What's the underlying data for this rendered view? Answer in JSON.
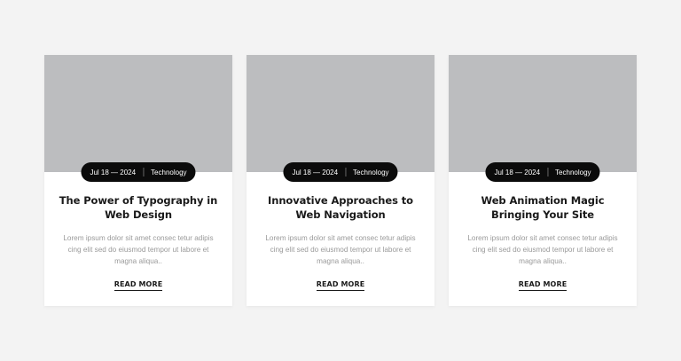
{
  "cards": [
    {
      "date": "Jul 18 — 2024",
      "category": "Technology",
      "title": "The Power of Typography in Web Design",
      "excerpt": "Lorem ipsum dolor sit amet consec tetur adipis cing elit sed do eiusmod tempor ut labore et magna aliqua..",
      "link_label": "READ MORE"
    },
    {
      "date": "Jul 18 — 2024",
      "category": "Technology",
      "title": "Innovative Approaches to Web Navigation",
      "excerpt": "Lorem ipsum dolor sit amet consec tetur adipis cing elit sed do eiusmod tempor ut labore et magna aliqua..",
      "link_label": "READ MORE"
    },
    {
      "date": "Jul 18 — 2024",
      "category": "Technology",
      "title": "Web Animation Magic Bringing Your Site",
      "excerpt": "Lorem ipsum dolor sit amet consec tetur adipis cing elit sed do eiusmod tempor ut labore et magna aliqua..",
      "link_label": "READ MORE"
    }
  ],
  "colors": {
    "background": "#f3f3f3",
    "card": "#ffffff",
    "image_placeholder": "#bcbdbf",
    "pill": "#0b0b0b",
    "title": "#1a1a1a",
    "excerpt": "#9a9a9a"
  }
}
